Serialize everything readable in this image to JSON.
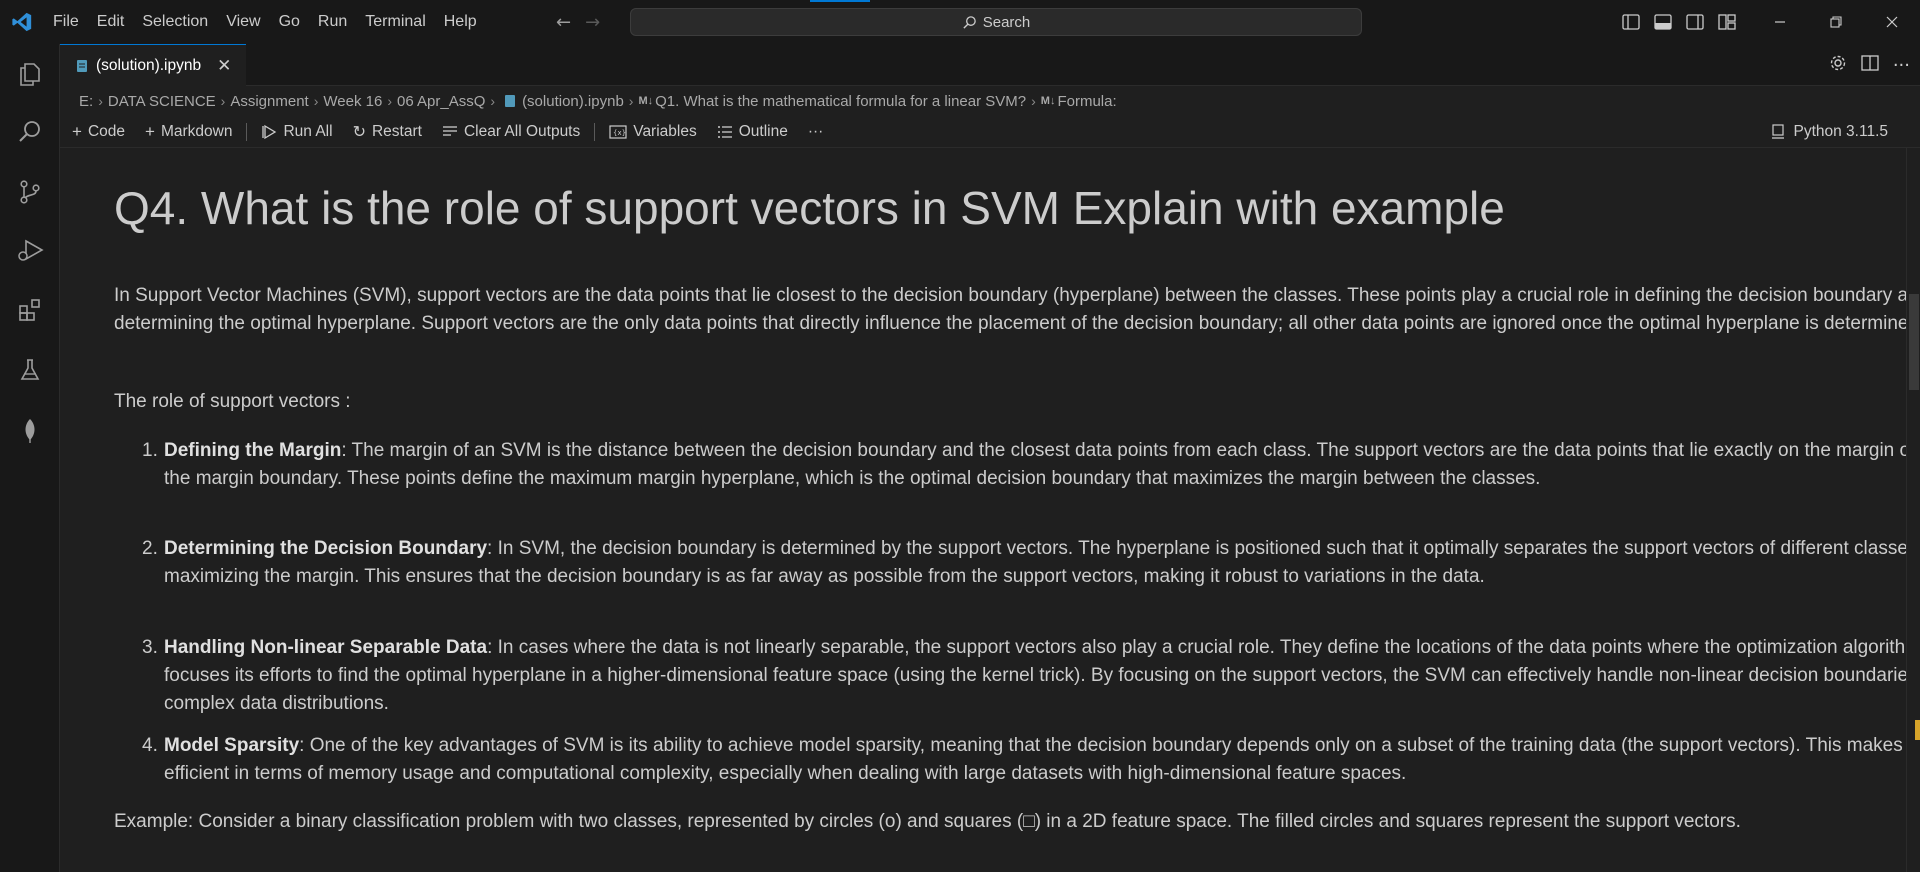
{
  "menu": [
    "File",
    "Edit",
    "Selection",
    "View",
    "Go",
    "Run",
    "Terminal",
    "Help"
  ],
  "search": {
    "label": "Search"
  },
  "tab": {
    "label": "(solution).ipynb",
    "close": "✕"
  },
  "breadcrumb": {
    "items": [
      "E:",
      "DATA SCIENCE",
      "Assignment",
      "Week 16",
      "06 Apr_AssQ",
      "(solution).ipynb",
      "Q1. What is the mathematical formula for a linear SVM?",
      "Formula:"
    ],
    "md_badge": "M↓"
  },
  "toolbar": {
    "code": "Code",
    "markdown": "Markdown",
    "run_all": "Run All",
    "restart": "Restart",
    "clear_outputs": "Clear All Outputs",
    "variables": "Variables",
    "outline": "Outline",
    "more": "···",
    "kernel": "Python 3.11.5"
  },
  "cell": {
    "heading": "Q4. What is the role of support vectors in SVM Explain with example",
    "intro": "In Support Vector Machines (SVM), support vectors are the data points that lie closest to the decision boundary (hyperplane) between the classes. These points play a crucial role in defining the decision boundary and determining the optimal hyperplane. Support vectors are the only data points that directly influence the placement of the decision boundary; all other data points are ignored once the optimal hyperplane is determined.",
    "role_label": "The role of support vectors :",
    "items": [
      {
        "num": "1.",
        "title": "Defining the Margin",
        "text": ": The margin of an SVM is the distance between the decision boundary and the closest data points from each class. The support vectors are the data points that lie exactly on the margin or within the margin boundary. These points define the maximum margin hyperplane, which is the optimal decision boundary that maximizes the margin between the classes."
      },
      {
        "num": "2.",
        "title": "Determining the Decision Boundary",
        "text": ": In SVM, the decision boundary is determined by the support vectors. The hyperplane is positioned such that it optimally separates the support vectors of different classes while maximizing the margin. This ensures that the decision boundary is as far away as possible from the support vectors, making it robust to variations in the data."
      },
      {
        "num": "3.",
        "title": "Handling Non-linear Separable Data",
        "text": ": In cases where the data is not linearly separable, the support vectors also play a crucial role. They define the locations of the data points where the optimization algorithm focuses its efforts to find the optimal hyperplane in a higher-dimensional feature space (using the kernel trick). By focusing on the support vectors, the SVM can effectively handle non-linear decision boundaries and complex data distributions."
      },
      {
        "num": "4.",
        "title": "Model Sparsity",
        "text": ": One of the key advantages of SVM is its ability to achieve model sparsity, meaning that the decision boundary depends only on a subset of the training data (the support vectors). This makes SVM efficient in terms of memory usage and computational complexity, especially when dealing with large datasets with high-dimensional feature spaces."
      }
    ],
    "example": "Example: Consider a binary classification problem with two classes, represented by circles (o) and squares (□) in a 2D feature space. The filled circles and squares represent the support vectors."
  },
  "colors": {
    "accent": "#0078d4",
    "background": "#1f1f1f",
    "chrome": "#181818",
    "scroll_marker": "#d7a42a"
  }
}
